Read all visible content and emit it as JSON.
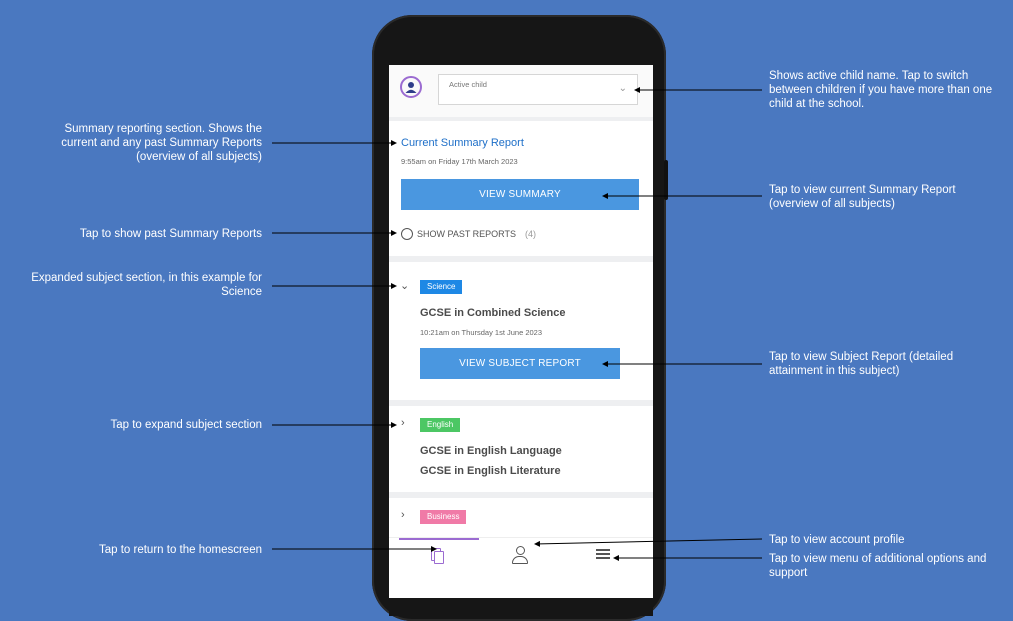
{
  "colors": {
    "background": "#4a78c0",
    "button_blue": "#4a97e0",
    "science_tag": "#1e88e5",
    "english_tag": "#4cc764",
    "business_tag": "#f07aa7",
    "active_tab_underline": "#9b6bd1"
  },
  "app": {
    "active_child": {
      "label": "Active child",
      "value": ""
    },
    "summary": {
      "title": "Current Summary Report",
      "timestamp": "9:55am on Friday 17th March 2023",
      "view_button": "VIEW SUMMARY",
      "past_reports_label": "SHOW PAST REPORTS",
      "past_reports_count": "(4)"
    },
    "subjects": [
      {
        "tag": "Science",
        "expanded": true,
        "courses": [
          "GCSE in Combined Science"
        ],
        "timestamp": "10:21am on Thursday 1st June 2023",
        "view_button": "VIEW SUBJECT REPORT"
      },
      {
        "tag": "English",
        "expanded": false,
        "courses": [
          "GCSE in English Language",
          "GCSE in English Literature"
        ]
      },
      {
        "tag": "Business",
        "expanded": false,
        "courses": []
      }
    ],
    "bottom_nav": [
      "home-icon",
      "profile-icon",
      "menu-icon"
    ]
  },
  "annotations": {
    "active_child": "Shows active child name. Tap to switch between children if you have more than one child at the school.",
    "summary_section": "Summary reporting section. Shows the current and any past Summary Reports (overview of all subjects)",
    "view_summary": "Tap to view current Summary Report (overview of all subjects)",
    "past_reports": "Tap to show past Summary Reports",
    "expanded_subject": "Expanded subject section, in this example for Science",
    "view_subject": "Tap to view Subject Report (detailed attainment in this subject)",
    "expand_subject": "Tap to expand subject section",
    "account_profile": "Tap to view account profile",
    "homescreen": "Tap to return to the homescreen",
    "menu": "Tap to view menu of additional options and support"
  }
}
